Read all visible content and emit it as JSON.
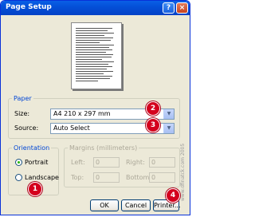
{
  "window": {
    "title": "Page Setup",
    "help_label": "?",
    "close_label": "×"
  },
  "paper": {
    "legend": "Paper",
    "size_label": "Size:",
    "size_value": "A4 210 x 297 mm",
    "source_label": "Source:",
    "source_value": "Auto Select"
  },
  "orientation": {
    "legend": "Orientation",
    "portrait_label": "Portrait",
    "landscape_label": "Landscape",
    "selected": "Portrait"
  },
  "margins": {
    "legend": "Margins (millimeters)",
    "left_label": "Left:",
    "left_value": "0",
    "right_label": "Right:",
    "right_value": "0",
    "top_label": "Top:",
    "top_value": "0",
    "bottom_label": "Bottom:",
    "bottom_value": "0"
  },
  "buttons": {
    "ok": "OK",
    "cancel": "Cancel",
    "printer": "Printer..."
  },
  "callouts": {
    "one": "1",
    "two": "2",
    "three": "3",
    "four": "4"
  },
  "watermark": "www.dfinatck.com 2005",
  "colors": {
    "titlebar": "#0450d8",
    "callout": "#d4001d",
    "legend_text": "#0046d5"
  }
}
